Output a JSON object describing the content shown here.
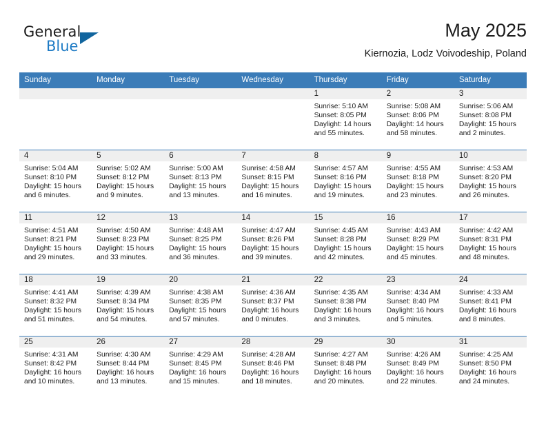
{
  "brand": {
    "name_top": "General",
    "name_bottom": "Blue",
    "triangle_color": "#11659e",
    "blue_color": "#1d7ac4"
  },
  "header": {
    "title": "May 2025",
    "subtitle": "Kiernozia, Lodz Voivodeship, Poland"
  },
  "theme": {
    "header_bg": "#3b7cb8",
    "daynum_bg": "#efefef",
    "text": "#1b1b1b"
  },
  "weekdays": [
    "Sunday",
    "Monday",
    "Tuesday",
    "Wednesday",
    "Thursday",
    "Friday",
    "Saturday"
  ],
  "labels": {
    "sunrise": "Sunrise:",
    "sunset": "Sunset:",
    "daylight": "Daylight:"
  },
  "weeks": [
    [
      {
        "day": "",
        "empty": true,
        "l1": "",
        "l2": "",
        "l3": "",
        "l4": ""
      },
      {
        "day": "",
        "empty": true,
        "l1": "",
        "l2": "",
        "l3": "",
        "l4": ""
      },
      {
        "day": "",
        "empty": true,
        "l1": "",
        "l2": "",
        "l3": "",
        "l4": ""
      },
      {
        "day": "",
        "empty": true,
        "l1": "",
        "l2": "",
        "l3": "",
        "l4": ""
      },
      {
        "day": "1",
        "empty": false,
        "l1": "Sunrise: 5:10 AM",
        "l2": "Sunset: 8:05 PM",
        "l3": "Daylight: 14 hours",
        "l4": "and 55 minutes."
      },
      {
        "day": "2",
        "empty": false,
        "l1": "Sunrise: 5:08 AM",
        "l2": "Sunset: 8:06 PM",
        "l3": "Daylight: 14 hours",
        "l4": "and 58 minutes."
      },
      {
        "day": "3",
        "empty": false,
        "l1": "Sunrise: 5:06 AM",
        "l2": "Sunset: 8:08 PM",
        "l3": "Daylight: 15 hours",
        "l4": "and 2 minutes."
      }
    ],
    [
      {
        "day": "4",
        "empty": false,
        "l1": "Sunrise: 5:04 AM",
        "l2": "Sunset: 8:10 PM",
        "l3": "Daylight: 15 hours",
        "l4": "and 6 minutes."
      },
      {
        "day": "5",
        "empty": false,
        "l1": "Sunrise: 5:02 AM",
        "l2": "Sunset: 8:12 PM",
        "l3": "Daylight: 15 hours",
        "l4": "and 9 minutes."
      },
      {
        "day": "6",
        "empty": false,
        "l1": "Sunrise: 5:00 AM",
        "l2": "Sunset: 8:13 PM",
        "l3": "Daylight: 15 hours",
        "l4": "and 13 minutes."
      },
      {
        "day": "7",
        "empty": false,
        "l1": "Sunrise: 4:58 AM",
        "l2": "Sunset: 8:15 PM",
        "l3": "Daylight: 15 hours",
        "l4": "and 16 minutes."
      },
      {
        "day": "8",
        "empty": false,
        "l1": "Sunrise: 4:57 AM",
        "l2": "Sunset: 8:16 PM",
        "l3": "Daylight: 15 hours",
        "l4": "and 19 minutes."
      },
      {
        "day": "9",
        "empty": false,
        "l1": "Sunrise: 4:55 AM",
        "l2": "Sunset: 8:18 PM",
        "l3": "Daylight: 15 hours",
        "l4": "and 23 minutes."
      },
      {
        "day": "10",
        "empty": false,
        "l1": "Sunrise: 4:53 AM",
        "l2": "Sunset: 8:20 PM",
        "l3": "Daylight: 15 hours",
        "l4": "and 26 minutes."
      }
    ],
    [
      {
        "day": "11",
        "empty": false,
        "l1": "Sunrise: 4:51 AM",
        "l2": "Sunset: 8:21 PM",
        "l3": "Daylight: 15 hours",
        "l4": "and 29 minutes."
      },
      {
        "day": "12",
        "empty": false,
        "l1": "Sunrise: 4:50 AM",
        "l2": "Sunset: 8:23 PM",
        "l3": "Daylight: 15 hours",
        "l4": "and 33 minutes."
      },
      {
        "day": "13",
        "empty": false,
        "l1": "Sunrise: 4:48 AM",
        "l2": "Sunset: 8:25 PM",
        "l3": "Daylight: 15 hours",
        "l4": "and 36 minutes."
      },
      {
        "day": "14",
        "empty": false,
        "l1": "Sunrise: 4:47 AM",
        "l2": "Sunset: 8:26 PM",
        "l3": "Daylight: 15 hours",
        "l4": "and 39 minutes."
      },
      {
        "day": "15",
        "empty": false,
        "l1": "Sunrise: 4:45 AM",
        "l2": "Sunset: 8:28 PM",
        "l3": "Daylight: 15 hours",
        "l4": "and 42 minutes."
      },
      {
        "day": "16",
        "empty": false,
        "l1": "Sunrise: 4:43 AM",
        "l2": "Sunset: 8:29 PM",
        "l3": "Daylight: 15 hours",
        "l4": "and 45 minutes."
      },
      {
        "day": "17",
        "empty": false,
        "l1": "Sunrise: 4:42 AM",
        "l2": "Sunset: 8:31 PM",
        "l3": "Daylight: 15 hours",
        "l4": "and 48 minutes."
      }
    ],
    [
      {
        "day": "18",
        "empty": false,
        "l1": "Sunrise: 4:41 AM",
        "l2": "Sunset: 8:32 PM",
        "l3": "Daylight: 15 hours",
        "l4": "and 51 minutes."
      },
      {
        "day": "19",
        "empty": false,
        "l1": "Sunrise: 4:39 AM",
        "l2": "Sunset: 8:34 PM",
        "l3": "Daylight: 15 hours",
        "l4": "and 54 minutes."
      },
      {
        "day": "20",
        "empty": false,
        "l1": "Sunrise: 4:38 AM",
        "l2": "Sunset: 8:35 PM",
        "l3": "Daylight: 15 hours",
        "l4": "and 57 minutes."
      },
      {
        "day": "21",
        "empty": false,
        "l1": "Sunrise: 4:36 AM",
        "l2": "Sunset: 8:37 PM",
        "l3": "Daylight: 16 hours",
        "l4": "and 0 minutes."
      },
      {
        "day": "22",
        "empty": false,
        "l1": "Sunrise: 4:35 AM",
        "l2": "Sunset: 8:38 PM",
        "l3": "Daylight: 16 hours",
        "l4": "and 3 minutes."
      },
      {
        "day": "23",
        "empty": false,
        "l1": "Sunrise: 4:34 AM",
        "l2": "Sunset: 8:40 PM",
        "l3": "Daylight: 16 hours",
        "l4": "and 5 minutes."
      },
      {
        "day": "24",
        "empty": false,
        "l1": "Sunrise: 4:33 AM",
        "l2": "Sunset: 8:41 PM",
        "l3": "Daylight: 16 hours",
        "l4": "and 8 minutes."
      }
    ],
    [
      {
        "day": "25",
        "empty": false,
        "l1": "Sunrise: 4:31 AM",
        "l2": "Sunset: 8:42 PM",
        "l3": "Daylight: 16 hours",
        "l4": "and 10 minutes."
      },
      {
        "day": "26",
        "empty": false,
        "l1": "Sunrise: 4:30 AM",
        "l2": "Sunset: 8:44 PM",
        "l3": "Daylight: 16 hours",
        "l4": "and 13 minutes."
      },
      {
        "day": "27",
        "empty": false,
        "l1": "Sunrise: 4:29 AM",
        "l2": "Sunset: 8:45 PM",
        "l3": "Daylight: 16 hours",
        "l4": "and 15 minutes."
      },
      {
        "day": "28",
        "empty": false,
        "l1": "Sunrise: 4:28 AM",
        "l2": "Sunset: 8:46 PM",
        "l3": "Daylight: 16 hours",
        "l4": "and 18 minutes."
      },
      {
        "day": "29",
        "empty": false,
        "l1": "Sunrise: 4:27 AM",
        "l2": "Sunset: 8:48 PM",
        "l3": "Daylight: 16 hours",
        "l4": "and 20 minutes."
      },
      {
        "day": "30",
        "empty": false,
        "l1": "Sunrise: 4:26 AM",
        "l2": "Sunset: 8:49 PM",
        "l3": "Daylight: 16 hours",
        "l4": "and 22 minutes."
      },
      {
        "day": "31",
        "empty": false,
        "l1": "Sunrise: 4:25 AM",
        "l2": "Sunset: 8:50 PM",
        "l3": "Daylight: 16 hours",
        "l4": "and 24 minutes."
      }
    ]
  ]
}
